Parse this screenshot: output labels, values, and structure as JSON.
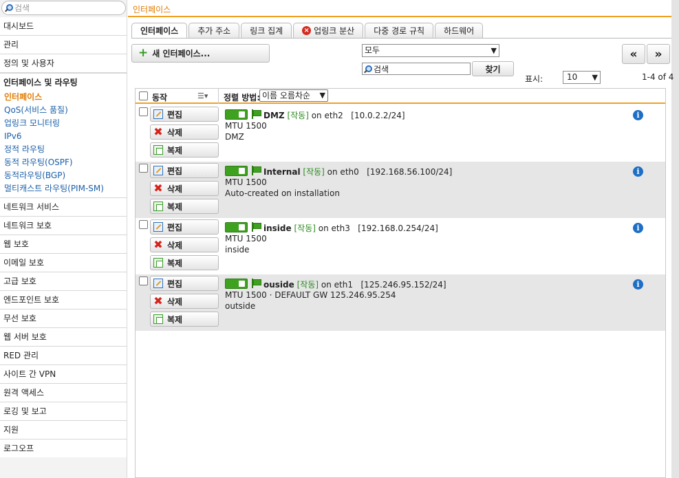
{
  "sidebar": {
    "search_placeholder": "검색",
    "items_top": [
      "대시보드",
      "관리",
      "정의 및 사용자"
    ],
    "group": {
      "title": "인터페이스 및 라우팅",
      "subitems": [
        "인터페이스",
        "QoS(서비스 품질)",
        "업링크 모니터링",
        "IPv6",
        "정적 라우팅",
        "동적 라우팅(OSPF)",
        "동적라우팅(BGP)",
        "멀티캐스트 라우팅(PIM-SM)"
      ]
    },
    "items_bottom": [
      "네트워크 서비스",
      "네트워크 보호",
      "웹 보호",
      "이메일 보호",
      "고급 보호",
      "엔드포인트 보호",
      "무선 보호",
      "웹 서버 보호",
      "RED 관리",
      "사이트 간 VPN",
      "원격 액세스",
      "로깅 및 보고",
      "지원",
      "로그오프"
    ]
  },
  "header": {
    "breadcrumb": "인터페이스"
  },
  "tabs": [
    {
      "label": "인터페이스",
      "active": true,
      "icon": null
    },
    {
      "label": "추가 주소",
      "active": false,
      "icon": null
    },
    {
      "label": "링크 집계",
      "active": false,
      "icon": null
    },
    {
      "label": "업링크 분산",
      "active": false,
      "icon": "error-icon"
    },
    {
      "label": "다중 경로 규칙",
      "active": false,
      "icon": null
    },
    {
      "label": "하드웨어",
      "active": false,
      "icon": null
    }
  ],
  "toolbar": {
    "new_label": "새 인터페이스...",
    "filter_value": "모두",
    "search_value": "검색",
    "find_label": "찾기",
    "prev_label": "«",
    "next_label": "»",
    "show_label": "표시:",
    "page_size": "10",
    "range": "1-4 of 4"
  },
  "table": {
    "action_header": "동작",
    "sort_label": "정렬 방법:",
    "sort_value": "이름 오름차순",
    "edit_label": "편집",
    "delete_label": "삭제",
    "copy_label": "복제",
    "rows": [
      {
        "name": "DMZ",
        "status": "[작동]",
        "on": "on eth2",
        "address": "[10.0.2.2/24]",
        "mtu": "MTU 1500",
        "comment": "DMZ"
      },
      {
        "name": "Internal",
        "status": "[작동]",
        "on": "on eth0",
        "address": "[192.168.56.100/24]",
        "mtu": "MTU 1500",
        "comment": "Auto-created on installation"
      },
      {
        "name": "inside",
        "status": "[작동]",
        "on": "on eth3",
        "address": "[192.168.0.254/24]",
        "mtu": "MTU 1500",
        "comment": "inside"
      },
      {
        "name": "ouside",
        "status": "[작동]",
        "on": "on eth1",
        "address": "[125.246.95.152/24]",
        "mtu": "MTU 1500 · DEFAULT GW 125.246.95.254",
        "comment": "outside"
      }
    ]
  },
  "colors": {
    "accent": "#f0a021",
    "active_nav": "#e07b00",
    "status_green": "#2b8a1f",
    "info_blue": "#1d6fc6"
  }
}
